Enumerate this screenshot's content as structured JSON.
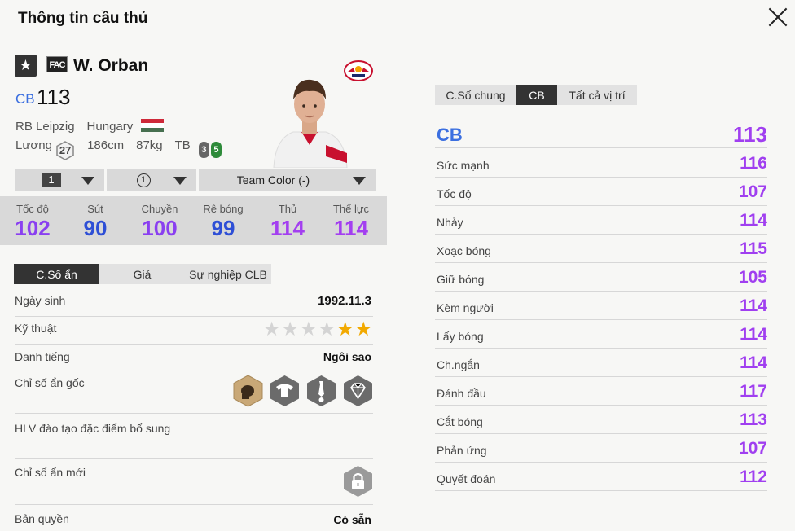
{
  "header": {
    "title": "Thông tin cầu thủ"
  },
  "player": {
    "name": "W. Orban",
    "badge": "FAC",
    "position": "CB",
    "overall": "113",
    "club": "RB Leipzig",
    "nation": "Hungary",
    "salary_label": "Lương",
    "salary": "27",
    "height": "186cm",
    "weight": "87kg",
    "body_type": "TB",
    "weak_foot": "3",
    "skill_moves": "5"
  },
  "selectors": {
    "level": "1",
    "upgrade": "1",
    "team_color": "Team Color (-)"
  },
  "summary_stats": [
    {
      "label": "Tốc độ",
      "value": "102",
      "color": "#8a3ff0"
    },
    {
      "label": "Sút",
      "value": "90",
      "color": "#2e4fd6"
    },
    {
      "label": "Chuyền",
      "value": "100",
      "color": "#8a3ff0"
    },
    {
      "label": "Rê bóng",
      "value": "99",
      "color": "#2e4fd6"
    },
    {
      "label": "Thủ",
      "value": "114",
      "color": "#a33ff0"
    },
    {
      "label": "Thể lực",
      "value": "114",
      "color": "#a33ff0"
    }
  ],
  "left_tabs": [
    "C.Số ẩn",
    "Giá",
    "Sự nghiệp CLB"
  ],
  "details": {
    "birthday_label": "Ngày sinh",
    "birthday": "1992.11.3",
    "skill_label": "Kỹ thuật",
    "skill_stars": 2,
    "reputation_label": "Danh tiếng",
    "reputation": "Ngôi sao",
    "hidden_traits_label": "Chỉ số ẩn gốc",
    "trait_icons": [
      "boxing-glove-icon",
      "buffalo-icon",
      "tie-ball-icon",
      "diamond-icon"
    ],
    "coach_label": "HLV đào tạo đặc điểm bổ sung",
    "new_traits_label": "Chỉ số ẩn mới",
    "license_label": "Bản quyền",
    "license": "Có sẵn"
  },
  "right_tabs": [
    "C.Số chung",
    "CB",
    "Tất cả vị trí"
  ],
  "position_rating": {
    "label": "CB",
    "value": "113"
  },
  "attributes": [
    {
      "label": "Sức mạnh",
      "value": "116"
    },
    {
      "label": "Tốc độ",
      "value": "107"
    },
    {
      "label": "Nhảy",
      "value": "114"
    },
    {
      "label": "Xoạc bóng",
      "value": "115"
    },
    {
      "label": "Giữ bóng",
      "value": "105"
    },
    {
      "label": "Kèm người",
      "value": "114"
    },
    {
      "label": "Lấy bóng",
      "value": "114"
    },
    {
      "label": "Ch.ngắn",
      "value": "114"
    },
    {
      "label": "Đánh đầu",
      "value": "117"
    },
    {
      "label": "Cắt bóng",
      "value": "113"
    },
    {
      "label": "Phản ứng",
      "value": "107"
    },
    {
      "label": "Quyết đoán",
      "value": "112"
    }
  ]
}
